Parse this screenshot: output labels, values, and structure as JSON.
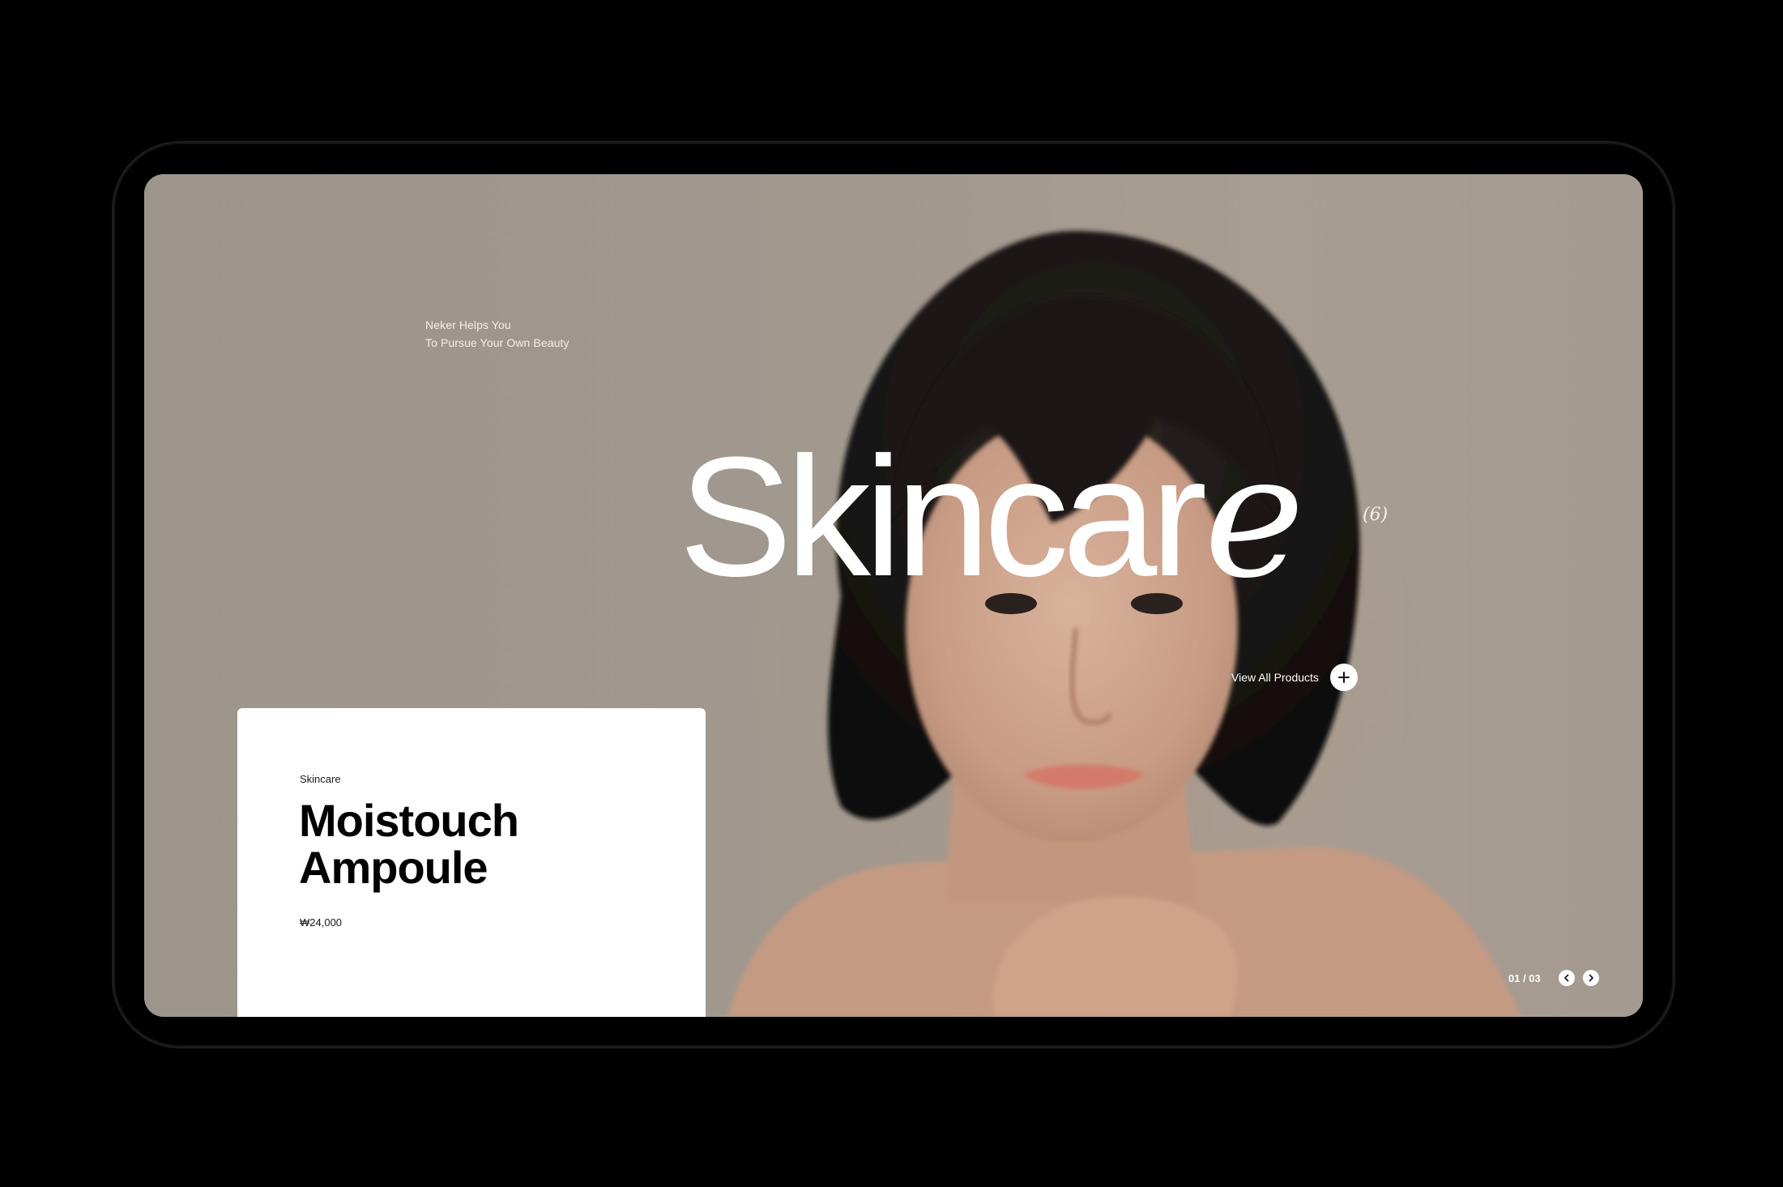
{
  "hero": {
    "tagline_line1": "Neker Helps You",
    "tagline_line2": "To Pursue Your Own Beauty",
    "title_main": "Skincar",
    "title_last": "e",
    "count": "(6)",
    "view_all_label": "View All Products"
  },
  "product_card": {
    "category": "Skincare",
    "title_line1": "Moistouch",
    "title_line2": "Ampoule",
    "price": "₩24,000"
  },
  "pager": {
    "current": "01 / 03"
  },
  "icons": {
    "view_all": "plus-icon",
    "prev": "chevron-left-icon",
    "next": "chevron-right-icon"
  },
  "colors": {
    "background": "#000000",
    "screen": "#a1988e",
    "text_light": "#ffffff",
    "card": "#ffffff",
    "card_text": "#000000"
  }
}
